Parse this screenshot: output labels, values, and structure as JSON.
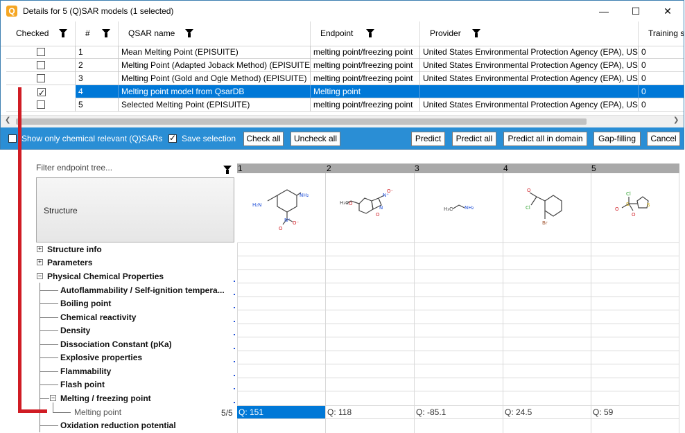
{
  "dialog": {
    "title": "Details for 5 (Q)SAR models (1 selected)",
    "app_icon": "Q",
    "window_buttons": {
      "minimize": "—",
      "maximize": "☐",
      "close": "✕"
    },
    "columns": [
      {
        "label": "Checked"
      },
      {
        "label": "#"
      },
      {
        "label": "QSAR name"
      },
      {
        "label": "Endpoint"
      },
      {
        "label": "Provider"
      },
      {
        "label": "Training s"
      }
    ],
    "rows": [
      {
        "checked": false,
        "num": "1",
        "name": "Mean Melting Point (EPISUITE)",
        "endpoint": "melting point/freezing point",
        "provider": "United States Environmental Protection Agency (EPA), USA",
        "training": "0"
      },
      {
        "checked": false,
        "num": "2",
        "name": "Melting Point (Adapted Joback Method) (EPISUITE)",
        "endpoint": "melting point/freezing point",
        "provider": "United States Environmental Protection Agency (EPA), USA",
        "training": "0"
      },
      {
        "checked": false,
        "num": "3",
        "name": "Melting Point (Gold and Ogle Method) (EPISUITE)",
        "endpoint": "melting point/freezing point",
        "provider": "United States Environmental Protection Agency (EPA), USA",
        "training": "0"
      },
      {
        "checked": true,
        "num": "4",
        "name": "Melting point model from QsarDB",
        "endpoint": "Melting point",
        "provider": "",
        "training": "0"
      },
      {
        "checked": false,
        "num": "5",
        "name": "Selected Melting Point (EPISUITE)",
        "endpoint": "melting point/freezing point",
        "provider": "United States Environmental Protection Agency (EPA), USA",
        "training": "0"
      }
    ],
    "toolbar": {
      "show_only_label": "Show only chemical relevant (Q)SARs",
      "save_selection_label": "Save selection",
      "check_all": "Check all",
      "uncheck_all": "Uncheck all",
      "predict": "Predict",
      "predict_all": "Predict all",
      "predict_all_domain": "Predict all in domain",
      "gap_filling": "Gap-filling",
      "cancel": "Cancel"
    }
  },
  "tree": {
    "filter_placeholder": "Filter endpoint tree...",
    "structure_label": "Structure",
    "items": [
      {
        "label": "Structure info",
        "sign": "+"
      },
      {
        "label": "Parameters",
        "sign": "+"
      },
      {
        "label": "Physical Chemical Properties",
        "sign": "−"
      },
      {
        "label": "Autoflammability / Self-ignition tempera..."
      },
      {
        "label": "Boiling point"
      },
      {
        "label": "Chemical reactivity"
      },
      {
        "label": "Density"
      },
      {
        "label": "Dissociation Constant (pKa)"
      },
      {
        "label": "Explosive properties"
      },
      {
        "label": "Flammability"
      },
      {
        "label": "Flash point"
      },
      {
        "label": "Melting / freezing point",
        "sign": "−"
      },
      {
        "label": "Melting point",
        "count": "5/5"
      },
      {
        "label": "Oxidation reduction potential"
      }
    ]
  },
  "matrix": {
    "columns": [
      "1",
      "2",
      "3",
      "4",
      "5"
    ],
    "values": [
      "Q: 151",
      "Q: 118",
      "Q: -85.1",
      "Q: 24.5",
      "Q: 59"
    ],
    "molecule_labels": [
      [
        "H₂N",
        "NH₂",
        "O",
        "N⁺",
        "O⁻"
      ],
      [
        "H₃C",
        "O",
        "N",
        "O",
        "N⁺",
        "O⁻"
      ],
      [
        "H₃C",
        "NH₂"
      ],
      [
        "O",
        "Cl",
        "Br"
      ],
      [
        "Cl",
        "S",
        "O",
        "O",
        "S"
      ]
    ]
  }
}
